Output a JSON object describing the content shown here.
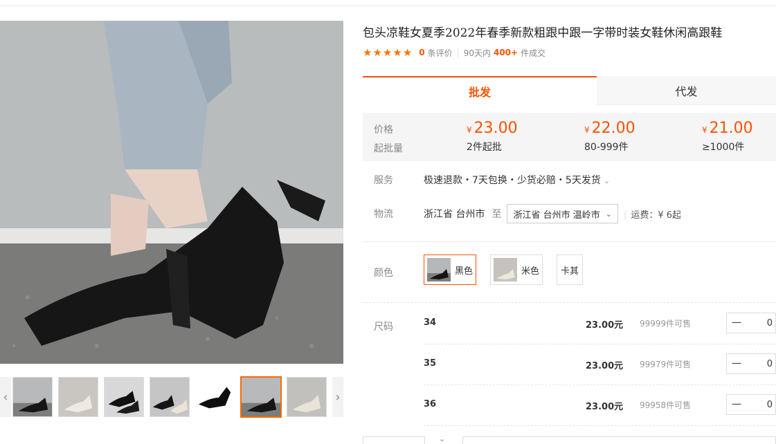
{
  "product": {
    "title": "包头凉鞋女夏季2022年春季新款粗跟中跟一字带时装女鞋休闲高跟鞋",
    "review_count": "0",
    "review_suffix": "条评价",
    "sales_period": "90天内",
    "sales_count": "400+",
    "sales_suffix": "件成交",
    "rating_stars": 5
  },
  "tabs": {
    "wholesale": "批发",
    "dropship": "代发"
  },
  "pricing": {
    "price_label": "价格",
    "moq_label": "起批量",
    "currency": "¥",
    "tiers": [
      {
        "price": "23.00",
        "moq": "2件起批"
      },
      {
        "price": "22.00",
        "moq": "80-999件"
      },
      {
        "price": "21.00",
        "moq": "≥1000件"
      }
    ]
  },
  "service": {
    "label": "服务",
    "text": "极速退款・7天包换・少货必赔・5天发货"
  },
  "logistics": {
    "label": "物流",
    "origin": "浙江省 台州市",
    "to": "至",
    "destination": "浙江省 台州市 温岭市",
    "freight": "运费：¥ 6起"
  },
  "colors": {
    "label": "颜色",
    "options": [
      {
        "name": "黑色",
        "selected": true
      },
      {
        "name": "米色",
        "selected": false
      },
      {
        "name": "卡其",
        "selected": false
      }
    ]
  },
  "sizes": {
    "label": "尺码",
    "rows": [
      {
        "size": "34",
        "price": "23.00元",
        "stock": "99999件可售",
        "qty": "0"
      },
      {
        "size": "35",
        "price": "23.00元",
        "stock": "99979件可售",
        "qty": "0"
      },
      {
        "size": "36",
        "price": "23.00元",
        "stock": "99958件可售",
        "qty": "0"
      }
    ]
  },
  "icons": {
    "star": "★",
    "chevron_down": "⌄",
    "arrow_left": "‹",
    "arrow_right": "›",
    "minus": "一"
  },
  "colors_theme": {
    "accent": "#ff5000",
    "star": "#ff7300"
  }
}
